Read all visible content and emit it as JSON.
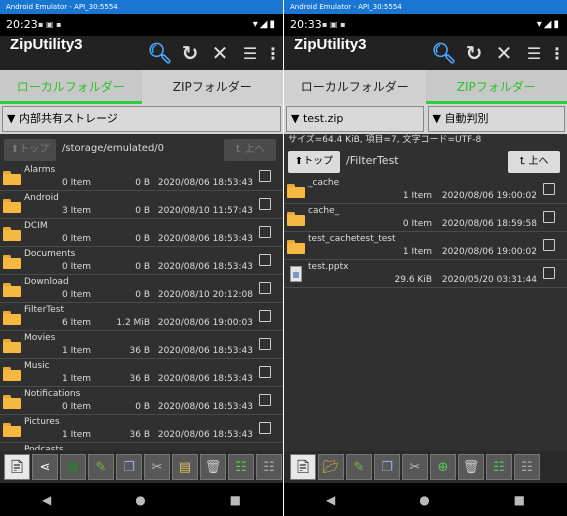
{
  "left": {
    "emulator_title": "Android Emulator - API_30:5554",
    "status_time": "20:23",
    "app_title": "ZipUtility3",
    "tabs": [
      "ローカルフォルダー",
      "ZIPフォルダー"
    ],
    "storage_dropdown": "内部共有ストレージ",
    "top_button": "トップ",
    "up_button": "上へ",
    "path": "/storage/emulated/0",
    "items": [
      {
        "name": "Alarms",
        "count": "0 Item",
        "size": "0 B",
        "date": "2020/08/06 18:53:43"
      },
      {
        "name": "Android",
        "count": "3 Item",
        "size": "0 B",
        "date": "2020/08/10 11:57:43"
      },
      {
        "name": "DCIM",
        "count": "0 Item",
        "size": "0 B",
        "date": "2020/08/06 18:53:43"
      },
      {
        "name": "Documents",
        "count": "0 Item",
        "size": "0 B",
        "date": "2020/08/06 18:53:43"
      },
      {
        "name": "Download",
        "count": "0 Item",
        "size": "0 B",
        "date": "2020/08/10 20:12:08"
      },
      {
        "name": "FilterTest",
        "count": "6 Item",
        "size": "1.2 MiB",
        "date": "2020/08/06 19:00:03"
      },
      {
        "name": "Movies",
        "count": "1 Item",
        "size": "36 B",
        "date": "2020/08/06 18:53:43"
      },
      {
        "name": "Music",
        "count": "1 Item",
        "size": "36 B",
        "date": "2020/08/06 18:53:43"
      },
      {
        "name": "Notifications",
        "count": "0 Item",
        "size": "0 B",
        "date": "2020/08/06 18:53:43"
      },
      {
        "name": "Pictures",
        "count": "1 Item",
        "size": "36 B",
        "date": "2020/08/06 18:53:43"
      },
      {
        "name": "Podcasts",
        "count": "",
        "size": "",
        "date": ""
      }
    ]
  },
  "right": {
    "emulator_title": "Android Emulator - API_30:5554",
    "status_time": "20:33",
    "app_title": "ZipUtility3",
    "tabs": [
      "ローカルフォルダー",
      "ZIPフォルダー"
    ],
    "zip_dropdown": "test.zip",
    "encoding_dropdown": "自動判別",
    "info": "サイズ=64.4 KiB, 項目=7, 文字コード=UTF-8",
    "top_button": "トップ",
    "up_button": "上へ",
    "path": "/FilterTest",
    "items": [
      {
        "name": "_cache",
        "type": "folder",
        "meta": "1 Item",
        "date": "2020/08/06 19:00:02"
      },
      {
        "name": "cache_",
        "type": "folder",
        "meta": "0 Item",
        "date": "2020/08/06 18:59:58"
      },
      {
        "name": "test_cachetest_test",
        "type": "folder",
        "meta": "1 Item",
        "date": "2020/08/06 19:00:02"
      },
      {
        "name": "test.pptx",
        "type": "file",
        "meta": "29.6 KiB",
        "date": "2020/05/20 03:31:44"
      }
    ]
  },
  "colors": {
    "accent_green": "#2ecc40",
    "emulator_blue": "#1976d2",
    "folder": "#f5b942"
  }
}
